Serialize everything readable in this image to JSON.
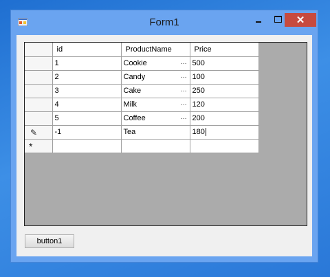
{
  "window": {
    "title": "Form1",
    "close_glyph": "✕"
  },
  "grid": {
    "columns": [
      "id",
      "ProductName",
      "Price"
    ],
    "rows": [
      {
        "id": "1",
        "name": "Cookie",
        "price": "500",
        "ellipsis": "..."
      },
      {
        "id": "2",
        "name": "Candy",
        "price": "100",
        "ellipsis": "..."
      },
      {
        "id": "3",
        "name": "Cake",
        "price": "250",
        "ellipsis": "..."
      },
      {
        "id": "4",
        "name": "Milk",
        "price": "120",
        "ellipsis": "..."
      },
      {
        "id": "5",
        "name": "Coffee",
        "price": "200",
        "ellipsis": "..."
      },
      {
        "id": "-1",
        "name": "Tea",
        "price": "180",
        "ellipsis": ""
      }
    ],
    "edit_row_icon": "pencil-icon",
    "new_row_icon": "asterisk-icon",
    "edit_glyph": "✎",
    "new_glyph": "*"
  },
  "buttons": {
    "button1": "button1"
  },
  "colors": {
    "close": "#c74a3e",
    "grid_background": "#ababab",
    "titlebar": "#6aa4f0"
  }
}
